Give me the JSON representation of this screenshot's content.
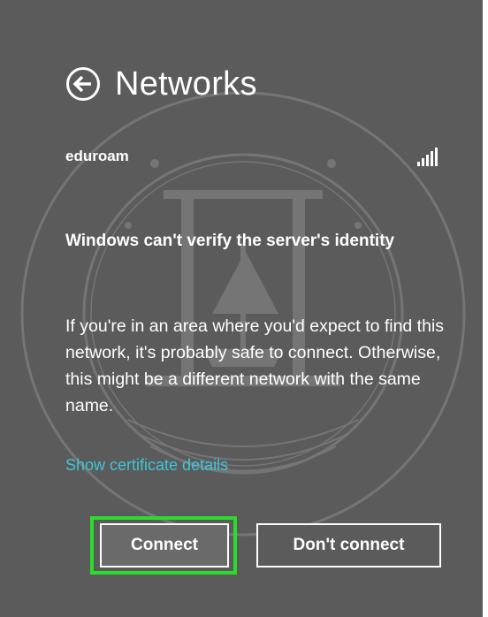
{
  "header": {
    "title": "Networks",
    "back_icon": "back-arrow-circle-icon"
  },
  "network": {
    "name": "eduroam",
    "signal_icon": "wifi-signal-bars-icon",
    "signal_bars": 5
  },
  "dialog": {
    "heading": "Windows can't verify the server's identity",
    "message": "If you're in an area where you'd expect to find this network, it's probably safe to connect. Otherwise, this might be a different network with the same name.",
    "link_label": "Show certificate details"
  },
  "buttons": {
    "connect_label": "Connect",
    "dont_connect_label": "Don't connect",
    "focused": "connect"
  },
  "colors": {
    "panel_bg": "#5b5b5b",
    "text": "#ffffff",
    "link": "#3fc6d6",
    "focus_highlight": "#2bdc2b"
  }
}
